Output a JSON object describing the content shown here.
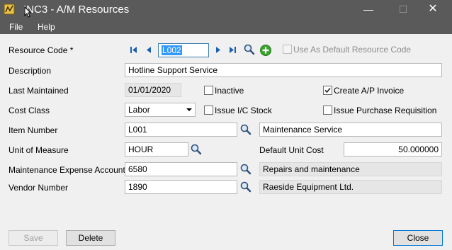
{
  "window": {
    "title": "INC3 - A/M Resources",
    "controls": {
      "minimize": "—",
      "maximize": "☐",
      "close": "✕"
    }
  },
  "menu": {
    "file": "File",
    "help": "Help"
  },
  "icons": {
    "app": "app-icon",
    "first": "first-record-icon",
    "prev": "previous-record-icon",
    "next": "next-record-icon",
    "last": "last-record-icon",
    "lookup": "magnifier-icon",
    "add": "add-icon"
  },
  "form": {
    "resource_code": {
      "label": "Resource Code *",
      "value": "L002"
    },
    "use_as_default": {
      "label": "Use As Default Resource Code",
      "checked": false,
      "enabled": false
    },
    "description": {
      "label": "Description",
      "value": "Hotline Support Service"
    },
    "last_maintained": {
      "label": "Last Maintained",
      "value": "01/01/2020"
    },
    "inactive": {
      "label": "Inactive",
      "checked": false
    },
    "create_ap_invoice": {
      "label": "Create A/P Invoice",
      "checked": true
    },
    "cost_class": {
      "label": "Cost Class",
      "value": "Labor"
    },
    "issue_ic_stock": {
      "label": "Issue I/C Stock",
      "checked": false
    },
    "issue_purchase_requisition": {
      "label": "Issue Purchase Requisition",
      "checked": false
    },
    "item_number": {
      "label": "Item Number",
      "value": "L001",
      "description": "Maintenance Service"
    },
    "unit_of_measure": {
      "label": "Unit of Measure",
      "value": "HOUR"
    },
    "default_unit_cost": {
      "label": "Default Unit Cost",
      "value": "50.000000"
    },
    "maintenance_expense_account": {
      "label": "Maintenance Expense Account",
      "value": "6580",
      "description": "Repairs and maintenance"
    },
    "vendor_number": {
      "label": "Vendor Number",
      "value": "1890",
      "description": "Raeside Equipment Ltd."
    }
  },
  "buttons": {
    "save": "Save",
    "delete": "Delete",
    "close": "Close"
  },
  "colors": {
    "titlebar": "#5a5a5a",
    "selection": "#3399ff",
    "nav_blue": "#1a5fb4",
    "add_green": "#3aa22c"
  }
}
